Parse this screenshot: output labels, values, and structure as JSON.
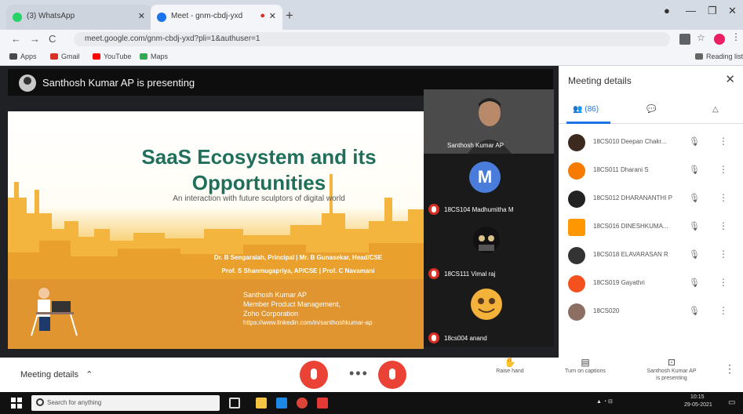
{
  "browser": {
    "tabs": [
      {
        "label": "(3) WhatsApp",
        "favicon_color": "#25d366"
      },
      {
        "label": "Meet - gnm-cbdj-yxd",
        "favicon_color": "#1a73e8"
      }
    ],
    "url": "meet.google.com/gnm-cbdj-yxd?pli=1&authuser=1",
    "bookmarks": [
      "Apps",
      "Gmail",
      "YouTube",
      "Maps"
    ],
    "reading_list": "Reading list"
  },
  "meet": {
    "presenting_banner": "Santhosh Kumar AP is presenting",
    "slide": {
      "title": "SaaS Ecosystem and its Opportunities",
      "subtitle": "An interaction with future sculptors of digital world",
      "names_line1": "Dr. B Sengaraiah, Principal | Mr. B Gunasekar, Head/CSE",
      "names_line2": "Prof. S Shanmugapriya, AP/CSE | Prof. C Navamani",
      "presenter_name": "Santhosh Kumar AP",
      "presenter_role": "Member Product Management,",
      "presenter_company": "Zoho Corporation",
      "presenter_link": "https://www.linkedin.com/in/santhoshkumar-ap"
    },
    "tiles": [
      {
        "name": "Santhosh Kumar AP",
        "muted": false
      },
      {
        "name": "18CS104 Madhumitha M",
        "muted": true,
        "initial": "M"
      },
      {
        "name": "18CS111 Vimal raj",
        "muted": true
      },
      {
        "name": "18cs004 anand",
        "muted": true
      }
    ],
    "panel": {
      "title": "Meeting details",
      "people_count": "(86)",
      "participants": [
        {
          "name": "18CS010 Deepan Chakr...",
          "color": "#3b2a1d"
        },
        {
          "name": "18CS011 Dharani S",
          "color": "#f57c00"
        },
        {
          "name": "18CS012 DHARANANTHI P",
          "color": "#222222"
        },
        {
          "name": "18CS016 DINESHKUMA...",
          "color": "#ff9800"
        },
        {
          "name": "18CS018 ELAVARASAN R",
          "color": "#333333"
        },
        {
          "name": "18CS019 Gayathri",
          "color": "#f4511e"
        },
        {
          "name": "18CS020",
          "color": "#8d6e63"
        }
      ]
    },
    "controls": {
      "meeting_details": "Meeting details",
      "raise_hand": "Raise hand",
      "turn_on_captions": "Turn on captions",
      "presenting_label_1": "Santhosh Kumar AP",
      "presenting_label_2": "is presenting"
    }
  },
  "taskbar": {
    "search_placeholder": "Search for anything",
    "time": "10:15",
    "date": "29-05-2021"
  }
}
